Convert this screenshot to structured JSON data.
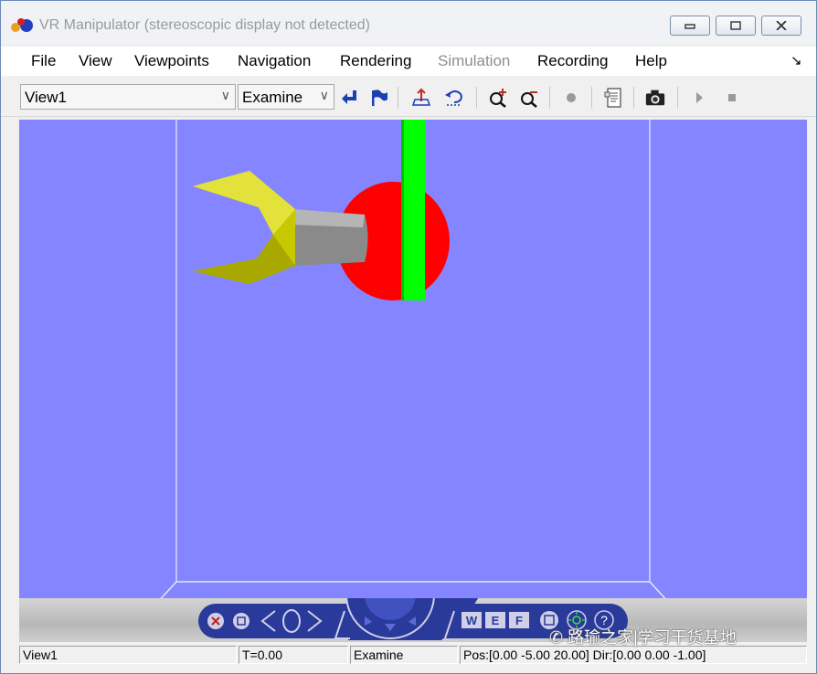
{
  "window": {
    "title": "VR Manipulator (stereoscopic display not detected)"
  },
  "menu": [
    {
      "label": "File",
      "enabled": true
    },
    {
      "label": "View",
      "enabled": true
    },
    {
      "label": "Viewpoints",
      "enabled": true
    },
    {
      "label": "Navigation",
      "enabled": true
    },
    {
      "label": "Rendering",
      "enabled": true
    },
    {
      "label": "Simulation",
      "enabled": false
    },
    {
      "label": "Recording",
      "enabled": true
    },
    {
      "label": "Help",
      "enabled": true
    }
  ],
  "toolbar": {
    "viewpoint_value": "View1",
    "navigation_value": "Examine",
    "icons": [
      "return-to-viewpoint-icon",
      "create-viewpoint-icon",
      "straighten-up-icon",
      "undo-move-icon",
      "zoom-in-icon",
      "zoom-out-icon",
      "record-icon",
      "capture-frame-icon",
      "snapshot-camera-icon",
      "play-icon",
      "stop-icon"
    ]
  },
  "scene": {
    "background_color": "#8585ff",
    "floor_line_color": "#ffffff",
    "gripper_color": "#c8c800",
    "arm_color": "#909090",
    "joint_color": "#ff0000",
    "column_color": "#00ff00"
  },
  "navpanel": {
    "buttons": [
      "W",
      "E",
      "F",
      "?"
    ]
  },
  "status": {
    "viewpoint": "View1",
    "time": "T=0.00",
    "mode": "Examine",
    "position": "Pos:[0.00 -5.00 20.00] Dir:[0.00 0.00 -1.00]"
  },
  "watermark": "路瑜之家|学习干货基地"
}
